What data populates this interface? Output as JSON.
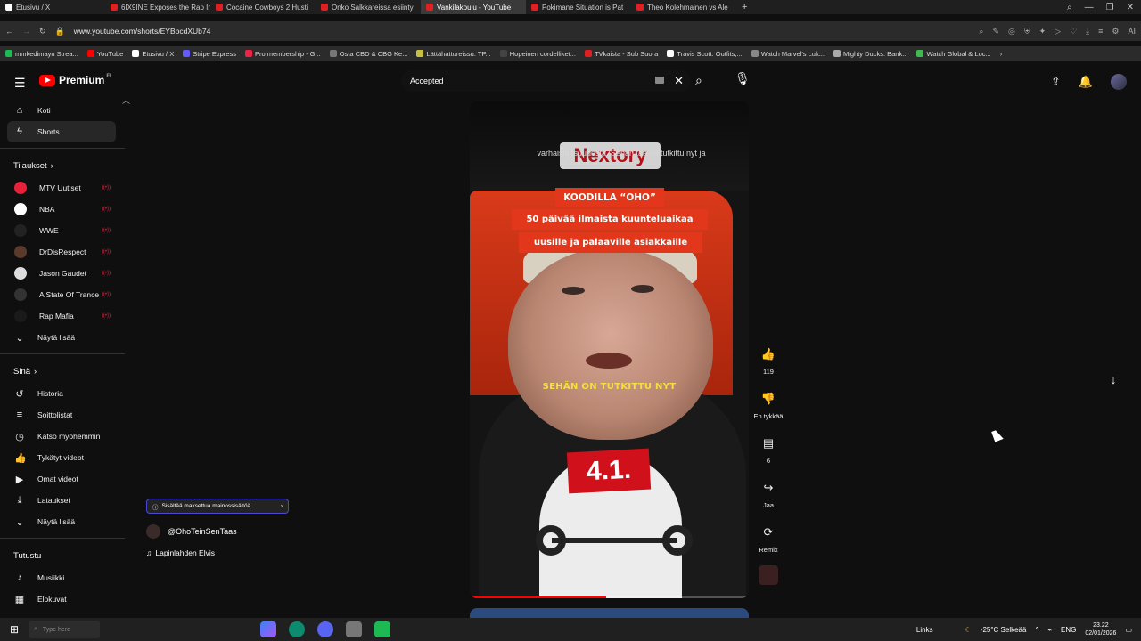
{
  "browser": {
    "tabs": [
      {
        "label": "Etusivu / X",
        "fav": "x"
      },
      {
        "label": "6IX9INE Exposes the Rap In",
        "fav": "yt"
      },
      {
        "label": "Cocaine Cowboys 2 Husti",
        "fav": "yt"
      },
      {
        "label": "Onko Salkkareissa esiinty",
        "fav": "yt"
      },
      {
        "label": "Vankilakoulu - YouTube",
        "fav": "yt",
        "active": true
      },
      {
        "label": "Pokimane Situation is Pat",
        "fav": "yt"
      },
      {
        "label": "Theo Kolehmainen vs Ale",
        "fav": "yt"
      }
    ],
    "new_tab": "+",
    "url": "www.youtube.com/shorts/EYBbcdXUb74",
    "bookmarks": [
      {
        "label": "mmkedimayn Strea...",
        "color": "#1db954"
      },
      {
        "label": "YouTube",
        "color": "#ff0000"
      },
      {
        "label": "Etusivu / X",
        "color": "#ffffff"
      },
      {
        "label": "Stripe Express",
        "color": "#635bff"
      },
      {
        "label": "Pro membership - G...",
        "color": "#e24"
      },
      {
        "label": "Osta CBD & CBG Ke...",
        "color": "#777"
      },
      {
        "label": "Lättähattureissu: TP...",
        "color": "#c8c040"
      },
      {
        "label": "Hopeinen cordelliket...",
        "color": "#444"
      },
      {
        "label": "TVkaista - Sub Suora",
        "color": "#e02020"
      },
      {
        "label": "Travis Scott: Outfits,...",
        "color": "#fff"
      },
      {
        "label": "Watch Marvel's Luk...",
        "color": "#888"
      },
      {
        "label": "Mighty Ducks: Bank...",
        "color": "#aaa"
      },
      {
        "label": "Watch Global & Loc...",
        "color": "#3fb950"
      }
    ]
  },
  "header": {
    "logo_text": "Premium",
    "region": "FI",
    "search_value": "Accepted"
  },
  "sidebar": {
    "main": [
      {
        "label": "Koti",
        "icon": "home-icon",
        "glyph": "⌂"
      },
      {
        "label": "Shorts",
        "icon": "shorts-icon",
        "glyph": "ϟ",
        "active": true
      }
    ],
    "subs_title": "Tilaukset",
    "subs": [
      {
        "label": "MTV Uutiset",
        "color": "#e8203a"
      },
      {
        "label": "NBA",
        "color": "#ffffff"
      },
      {
        "label": "WWE",
        "color": "#222222"
      },
      {
        "label": "DrDisRespect",
        "color": "#5a3a2a"
      },
      {
        "label": "Jason Gaudet",
        "color": "#dddddd"
      },
      {
        "label": "A State Of Trance",
        "color": "#333333"
      },
      {
        "label": "Rap Mafia",
        "color": "#1a1a1a"
      }
    ],
    "show_more": "Näytä lisää",
    "you_title": "Sinä",
    "you": [
      {
        "label": "Historia",
        "glyph": "↺"
      },
      {
        "label": "Soittolistat",
        "glyph": "≡"
      },
      {
        "label": "Katso myöhemmin",
        "glyph": "◷"
      },
      {
        "label": "Tykätyt videot",
        "glyph": "👍"
      },
      {
        "label": "Omat videot",
        "glyph": "▶"
      },
      {
        "label": "Lataukset",
        "glyph": "⤓"
      },
      {
        "label": "Näytä lisää",
        "glyph": "⌄"
      }
    ],
    "explore_title": "Tutustu",
    "explore": [
      {
        "label": "Musiikki",
        "glyph": "♪"
      },
      {
        "label": "Elokuvat",
        "glyph": "▦"
      }
    ]
  },
  "short": {
    "top_caption": "varhaislapsuudesta. Sehän tää on tutkittu nyt ja",
    "brand_logo": "Nextory",
    "promo_lines": [
      "KOODILLA “OHO”",
      "50 päivää ilmaista kuunteluaikaa",
      "uusille ja palaaville asiakkaille"
    ],
    "subtitle": "SEHÄN ON TUTKITTU NYT",
    "shirt_badge": "4.1.",
    "progress": 0.49,
    "paid_label": "Sisältää maksettua mainossisältöä",
    "channel": "@OhoTeinSenTaas",
    "music": "Lapinlahden Elvis"
  },
  "actions": {
    "likes": "119",
    "dislike_label": "En tykkää",
    "comments": "6",
    "share_label": "Jaa",
    "remix_label": "Remix"
  },
  "taskbar": {
    "search_placeholder": "Type here",
    "links": "Links",
    "weather": "-25°C  Selkeää",
    "lang": "ENG",
    "time": "23.22",
    "date": "02/01/2026"
  }
}
